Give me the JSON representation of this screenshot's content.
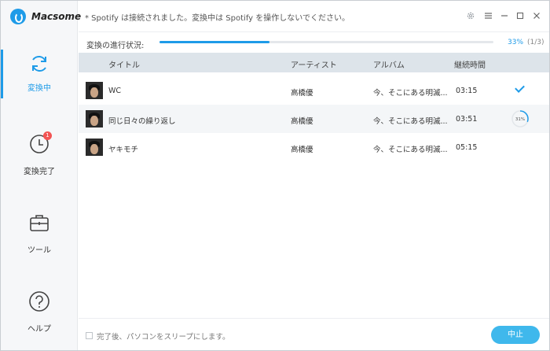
{
  "app": {
    "name": "Macsome",
    "notice": "* Spotify は接続されました。変換中は Spotify を操作しないでください。"
  },
  "sidebar": {
    "items": [
      {
        "label": "変換中",
        "icon": "refresh-icon",
        "active": true
      },
      {
        "label": "変換完了",
        "icon": "clock-icon",
        "badge": "1"
      },
      {
        "label": "ツール",
        "icon": "toolbox-icon"
      },
      {
        "label": "ヘルプ",
        "icon": "help-icon"
      }
    ]
  },
  "progress": {
    "label": "変換の進行状況:",
    "percent_text": "33%",
    "count_text": "(1/3)",
    "fraction": 0.33
  },
  "table": {
    "columns": [
      "タイトル",
      "アーティスト",
      "アルバム",
      "継続時間"
    ],
    "rows": [
      {
        "title": "WC",
        "artist": "高橋優",
        "album": "今、そこにある明滅...",
        "duration": "03:15",
        "status": "done"
      },
      {
        "title": "同じ日々の繰り返し",
        "artist": "高橋優",
        "album": "今、そこにある明滅...",
        "duration": "03:51",
        "status": "converting",
        "status_text": "31%",
        "status_fraction": 0.31
      },
      {
        "title": "ヤキモチ",
        "artist": "高橋優",
        "album": "今、そこにある明滅...",
        "duration": "05:15",
        "status": "waiting"
      }
    ]
  },
  "footer": {
    "sleep_label": "完了後、パソコンをスリープにします。",
    "stop_button": "中止"
  },
  "colors": {
    "accent": "#1e9be8",
    "button": "#3fb8ec",
    "badge": "#f25454",
    "header_row": "#dde4ea"
  }
}
